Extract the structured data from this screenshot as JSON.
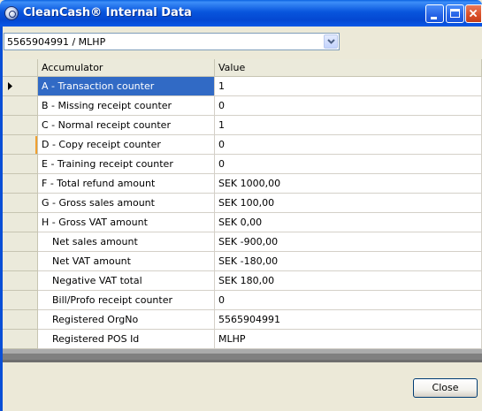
{
  "window": {
    "title": "CleanCash® Internal Data",
    "app_icon": "cleancash-logo-icon",
    "controls": [
      "minimize-icon",
      "maximize-icon",
      "close-icon"
    ]
  },
  "device_select": {
    "selected": "5565904991 / MLHP"
  },
  "grid": {
    "columns": [
      "Accumulator",
      "Value"
    ],
    "rows": [
      {
        "accumulator": "A - Transaction counter",
        "value": "1"
      },
      {
        "accumulator": "B - Missing receipt counter",
        "value": "0"
      },
      {
        "accumulator": "C - Normal receipt counter",
        "value": "1"
      },
      {
        "accumulator": "D - Copy receipt counter",
        "value": "0"
      },
      {
        "accumulator": "E - Training receipt counter",
        "value": "0"
      },
      {
        "accumulator": "F - Total refund amount",
        "value": "SEK 1000,00"
      },
      {
        "accumulator": "G - Gross sales amount",
        "value": "SEK 100,00"
      },
      {
        "accumulator": "H - Gross VAT amount",
        "value": "SEK 0,00"
      },
      {
        "accumulator": "Net sales amount",
        "value": "SEK -900,00"
      },
      {
        "accumulator": "Net VAT amount",
        "value": "SEK -180,00"
      },
      {
        "accumulator": "Negative VAT total",
        "value": "SEK 180,00"
      },
      {
        "accumulator": "Bill/Profo receipt counter",
        "value": "0"
      },
      {
        "accumulator": "Registered OrgNo",
        "value": "5565904991"
      },
      {
        "accumulator": "Registered POS Id",
        "value": "MLHP"
      }
    ],
    "selected_row": 0
  },
  "footer": {
    "close_label": "Close"
  },
  "colors": {
    "titlebar": "#0855dd",
    "selection": "#316ac5",
    "window_bg": "#ece9d8"
  }
}
